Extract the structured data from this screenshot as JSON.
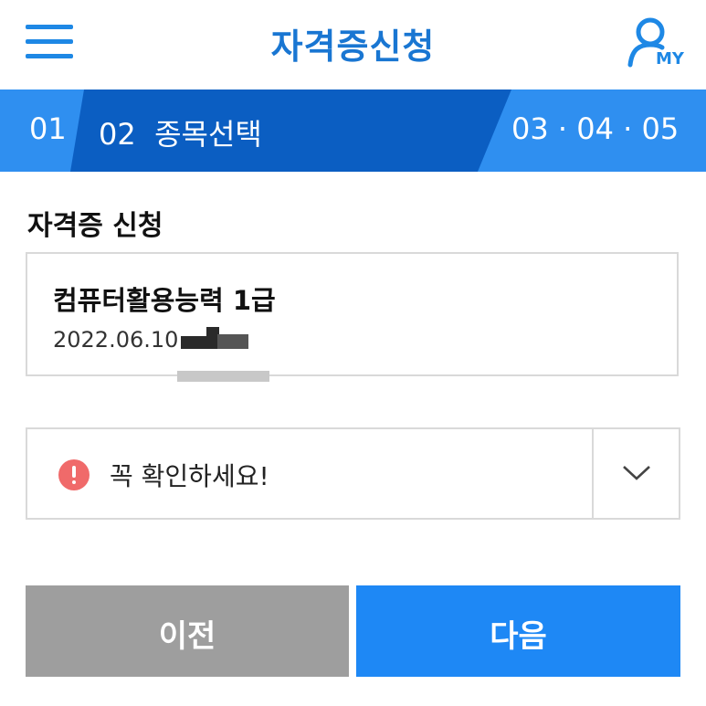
{
  "header": {
    "title": "자격증신청",
    "menu_icon": "hamburger-menu-icon",
    "my_icon": "user-icon",
    "my_label": "MY"
  },
  "steps": {
    "step1": "01",
    "step2": "02",
    "step2_label": "종목선택",
    "remaining": "03 · 04 · 05"
  },
  "section": {
    "title": "자격증 신청"
  },
  "application": {
    "name": "컴퓨터활용능력 1급",
    "date": "2022.06.10"
  },
  "notice": {
    "text": "꼭 확인하세요!",
    "icon": "exclamation-circle-icon",
    "toggle_icon": "chevron-down-icon"
  },
  "buttons": {
    "prev": "이전",
    "next": "다음"
  },
  "colors": {
    "primary": "#1E88F5",
    "step_active": "#0B5EC2",
    "step_bar": "#2F8FF0",
    "alert": "#F06A6A",
    "prev_button": "#9E9E9E"
  }
}
